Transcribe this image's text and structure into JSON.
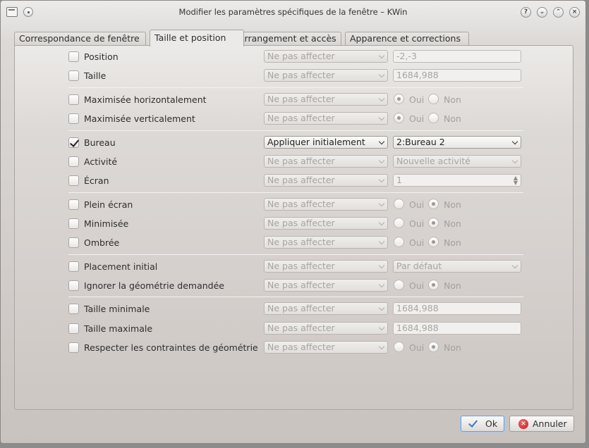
{
  "window": {
    "title": "Modifier les paramètres spécifiques de la fenêtre – KWin",
    "buttons": [
      "?",
      "⌄",
      "⌃",
      "×"
    ]
  },
  "tabs": [
    {
      "label": "Correspondance de fenêtre"
    },
    {
      "label": "Taille et position"
    },
    {
      "label": "Arrangement et accès"
    },
    {
      "label": "Apparence et corrections"
    }
  ],
  "rows": {
    "position": {
      "label": "Position",
      "checked": false,
      "policy": "Ne pas affecter",
      "value": "-2,-3"
    },
    "taille": {
      "label": "Taille",
      "checked": false,
      "policy": "Ne pas affecter",
      "value": "1684,988"
    },
    "max_h": {
      "label": "Maximisée horizontalement",
      "checked": false,
      "policy": "Ne pas affecter",
      "yes": "Oui",
      "no": "Non",
      "selected": "Oui"
    },
    "max_v": {
      "label": "Maximisée verticalement",
      "checked": false,
      "policy": "Ne pas affecter",
      "yes": "Oui",
      "no": "Non",
      "selected": "Oui"
    },
    "bureau": {
      "label": "Bureau",
      "checked": true,
      "policy": "Appliquer initialement",
      "value": "2:Bureau 2"
    },
    "activite": {
      "label": "Activité",
      "checked": false,
      "policy": "Ne pas affecter",
      "value": "Nouvelle activité"
    },
    "ecran": {
      "label": "Écran",
      "checked": false,
      "policy": "Ne pas affecter",
      "value": "1"
    },
    "plein_ecran": {
      "label": "Plein écran",
      "checked": false,
      "policy": "Ne pas affecter",
      "yes": "Oui",
      "no": "Non",
      "selected": "Non"
    },
    "minimisee": {
      "label": "Minimisée",
      "checked": false,
      "policy": "Ne pas affecter",
      "yes": "Oui",
      "no": "Non",
      "selected": "Non"
    },
    "ombree": {
      "label": "Ombrée",
      "checked": false,
      "policy": "Ne pas affecter",
      "yes": "Oui",
      "no": "Non",
      "selected": "Non"
    },
    "placement": {
      "label": "Placement initial",
      "checked": false,
      "policy": "Ne pas affecter",
      "value": "Par défaut"
    },
    "ignorer_geo": {
      "label": "Ignorer la géométrie demandée",
      "checked": false,
      "policy": "Ne pas affecter",
      "yes": "Oui",
      "no": "Non",
      "selected": "Non"
    },
    "taille_min": {
      "label": "Taille minimale",
      "checked": false,
      "policy": "Ne pas affecter",
      "value": "1684,988"
    },
    "taille_max": {
      "label": "Taille maximale",
      "checked": false,
      "policy": "Ne pas affecter",
      "value": "1684,988"
    },
    "contraintes": {
      "label": "Respecter les contraintes de géométrie",
      "checked": false,
      "policy": "Ne pas affecter",
      "yes": "Oui",
      "no": "Non",
      "selected": "Non"
    }
  },
  "footer": {
    "ok_label": "Ok",
    "cancel_label": "Annuler"
  }
}
